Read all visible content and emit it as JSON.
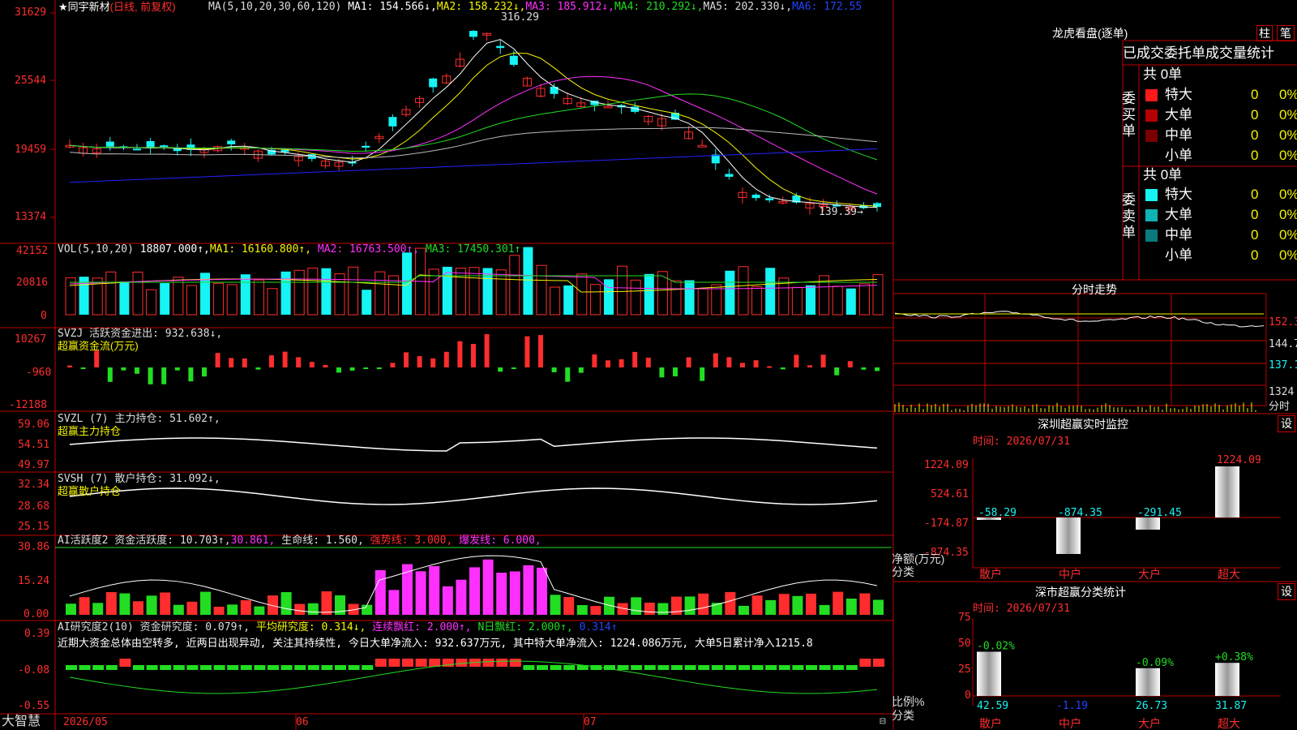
{
  "colors": {
    "up": "#ff2d2d",
    "down": "#16f4f4",
    "grid": "#c00000",
    "yellow": "#f4f400",
    "magenta": "#ff30ff",
    "green": "#22dd22",
    "white": "#ffffff",
    "gray": "#bbbbbb",
    "blue": "#2222ff"
  },
  "header": {
    "star": "★",
    "stock_name": "同宇新材",
    "mode": "(日线, 前复权)",
    "ma_title": "MA(5,10,20,30,60,120)",
    "ma": [
      {
        "label": "MA1: 154.566↓,",
        "color": "#ffffff"
      },
      {
        "label": "MA2: 158.232↓,",
        "color": "#f4f400"
      },
      {
        "label": "MA3: 185.912↓,",
        "color": "#ff30ff"
      },
      {
        "label": "MA4: 210.292↓,",
        "color": "#22dd22"
      },
      {
        "label": "MA5: 202.330↓,",
        "color": "#dddddd"
      },
      {
        "label": "MA6: 172.55",
        "color": "#2244ff"
      }
    ]
  },
  "price_panel": {
    "ticks": [
      "31629",
      "25544",
      "19459",
      "13374"
    ],
    "high_note": "316.29",
    "low_note": "139.39→"
  },
  "vol_panel": {
    "title": "VOL(5,10,20)",
    "value": "18807.000↑,",
    "ma1": "MA1: 16160.800↑,",
    "ma2": "MA2: 16763.500↑,",
    "ma3": "MA3: 17450.301↑",
    "ticks": [
      "42152",
      "20816",
      "0"
    ]
  },
  "svzj_panel": {
    "title": "SVZJ  活跃资金进出: 932.638↓,",
    "subtitle": "超赢资金流(万元)",
    "ticks": [
      "10267",
      "-960",
      "-12188"
    ]
  },
  "svzl_panel": {
    "title": "SVZL (7) 主力持仓: 51.602↑,",
    "subtitle": "超赢主力持仓",
    "ticks": [
      "59.06",
      "54.51",
      "49.97"
    ]
  },
  "svsh_panel": {
    "title": "SVSH (7) 散户持仓: 31.092↓,",
    "subtitle": "超赢散户持仓",
    "ticks": [
      "32.34",
      "28.68",
      "25.15"
    ]
  },
  "ai_active_panel": {
    "title": "AI活跃度2 资金活跃度: 10.703↑,",
    "v2": "30.861,",
    "life": "生命线: 1.560,",
    "strong": "强势线: 3.000,",
    "burst": "爆发线: 6.000,",
    "ticks": [
      "30.86",
      "15.24",
      "0.00"
    ]
  },
  "ai_research_panel": {
    "title": "AI研究度2(10) 资金研究度: 0.079↑,",
    "avg": "平均研究度: 0.314↓,",
    "red": "连续飘红: 2.000↑,",
    "nred": "N日飘红: 2.000↑,",
    "last": "0.314↑",
    "comment": "近期大资金总体由空转多, 近两日出现异动, 关注其持续性, 今日大单净流入: 932.637万元, 其中特大单净流入: 1224.086万元, 大单5日累计净入1215.8",
    "ticks": [
      "0.39",
      "-0.08",
      "-0.55"
    ]
  },
  "bottom_bar": {
    "brand": "大智慧",
    "dates": [
      "2026/05",
      "06",
      "07"
    ]
  },
  "dragon": {
    "title": "龙虎看盘(逐单)",
    "btn1": "柱",
    "btn2": "笔",
    "subtitle": "已成交委托单成交量统计",
    "buy_label": "委买单",
    "sell_label": "委卖单",
    "buy_total": "共 0单",
    "sell_total": "共 0单",
    "buy_rows": [
      {
        "name": "特大",
        "count": "0",
        "pct": "0%",
        "color": "#ff1a1a"
      },
      {
        "name": "大单",
        "count": "0",
        "pct": "0%",
        "color": "#b30000"
      },
      {
        "name": "中单",
        "count": "0",
        "pct": "0%",
        "color": "#7a0000"
      },
      {
        "name": "小单",
        "count": "0",
        "pct": "0%",
        "color": "#000000"
      }
    ],
    "sell_rows": [
      {
        "name": "特大",
        "count": "0",
        "pct": "0%",
        "color": "#16f4f4"
      },
      {
        "name": "大单",
        "count": "0",
        "pct": "0%",
        "color": "#0fb3b3"
      },
      {
        "name": "中单",
        "count": "0",
        "pct": "0%",
        "color": "#0a7a7a"
      },
      {
        "name": "小单",
        "count": "0",
        "pct": "0%",
        "color": "#000000"
      }
    ]
  },
  "intraday": {
    "title": "分时走势",
    "ticks": [
      "152.3",
      "144.7",
      "137.1",
      "1324"
    ],
    "bottom": "分时"
  },
  "sz_monitor": {
    "title": "深圳超赢实时监控",
    "btn": "设",
    "time": "时间: 2026/07/31",
    "ticks": [
      "1224.09",
      "524.61",
      "-174.87",
      "-874.35"
    ],
    "ylabel": "净额(万元)",
    "xlabel": "分类",
    "categories": [
      "散户",
      "中户",
      "大户",
      "超大"
    ],
    "values": [
      -58.29,
      -874.35,
      -291.45,
      1224.09
    ],
    "value_labels": [
      "-58.29",
      "-874.35",
      "-291.45",
      "1224.09"
    ]
  },
  "sz_class": {
    "title": "深市超赢分类统计",
    "btn": "设",
    "time": "时间: 2026/07/31",
    "ticks": [
      "75",
      "50",
      "25",
      "0"
    ],
    "ylabel": "比例%",
    "xlabel": "分类",
    "categories": [
      "散户",
      "中户",
      "大户",
      "超大"
    ],
    "values": [
      42.59,
      -1.19,
      26.73,
      31.87
    ],
    "bottom_labels": [
      "42.59",
      "-1.19",
      "26.73",
      "31.87"
    ],
    "top_labels": [
      "-0.02%",
      "",
      "-0.09%",
      "+0.38%"
    ]
  }
}
